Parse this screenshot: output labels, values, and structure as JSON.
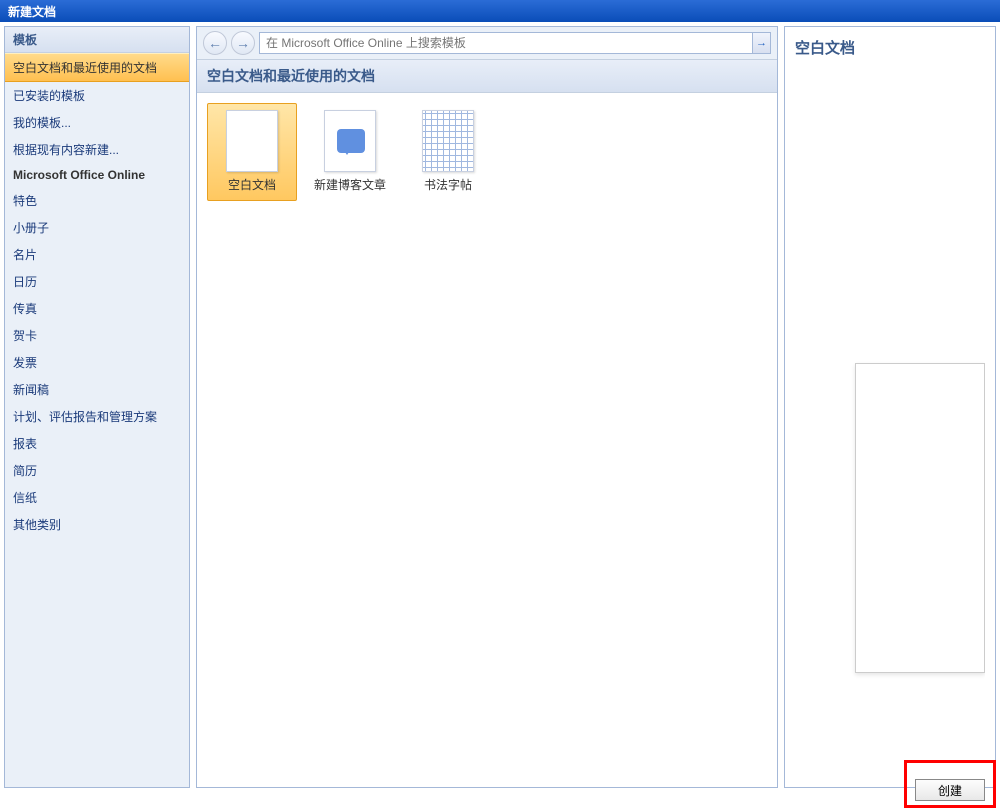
{
  "window": {
    "title": "新建文档"
  },
  "sidebar": {
    "header": "模板",
    "items": [
      {
        "label": "空白文档和最近使用的文档",
        "selected": true
      },
      {
        "label": "已安装的模板"
      },
      {
        "label": "我的模板..."
      },
      {
        "label": "根据现有内容新建..."
      },
      {
        "label": "Microsoft Office Online",
        "sectionHeader": true
      },
      {
        "label": "特色"
      },
      {
        "label": "小册子"
      },
      {
        "label": "名片"
      },
      {
        "label": "日历"
      },
      {
        "label": "传真"
      },
      {
        "label": "贺卡"
      },
      {
        "label": "发票"
      },
      {
        "label": "新闻稿"
      },
      {
        "label": "计划、评估报告和管理方案"
      },
      {
        "label": "报表"
      },
      {
        "label": "简历"
      },
      {
        "label": "信纸"
      },
      {
        "label": "其他类别"
      }
    ]
  },
  "search": {
    "placeholder": "在 Microsoft Office Online 上搜索模板"
  },
  "main": {
    "sectionTitle": "空白文档和最近使用的文档",
    "templates": [
      {
        "label": "空白文档",
        "iconType": "blank",
        "selected": true
      },
      {
        "label": "新建博客文章",
        "iconType": "blog"
      },
      {
        "label": "书法字帖",
        "iconType": "grid"
      }
    ]
  },
  "preview": {
    "title": "空白文档"
  },
  "footer": {
    "createLabel": "创建"
  }
}
